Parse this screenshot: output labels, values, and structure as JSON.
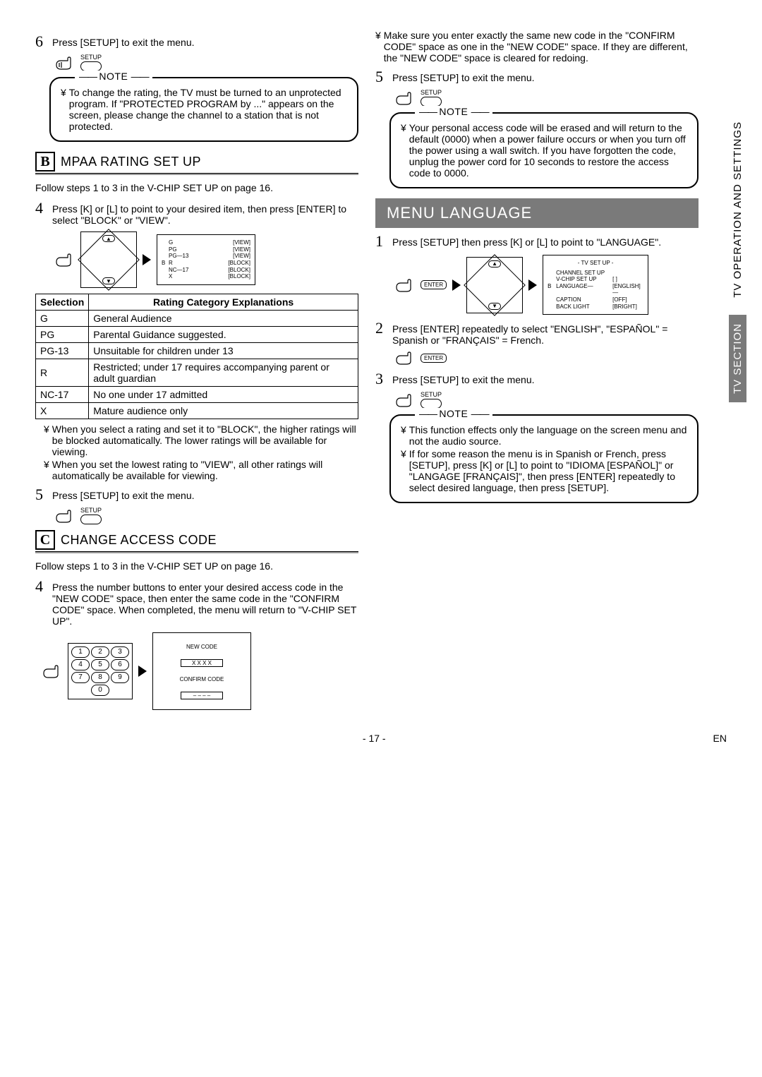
{
  "left": {
    "step6_text": "Press [SETUP] to exit the menu.",
    "setup_label": "SETUP",
    "note1_title": "NOTE",
    "note1_text": "To change the rating, the TV must be turned to an unprotected program. If \"PROTECTED PROGRAM by ...\" appears on the screen, please change the channel to a station that is not protected.",
    "sectionB_letter": "B",
    "sectionB_title": "MPAA RATING SET UP",
    "follow_b": "Follow steps 1 to 3 in the V-CHIP SET UP on page 16.",
    "step4b_text": "Press [K] or [L] to point to your desired item, then press [ENTER] to select \"BLOCK\" or \"VIEW\".",
    "rating_screen": [
      {
        "mark": "",
        "code": "G",
        "state": "[VIEW]"
      },
      {
        "mark": "",
        "code": "PG",
        "state": "[VIEW]"
      },
      {
        "mark": "",
        "code": "PG—13",
        "state": "[VIEW]"
      },
      {
        "mark": "B",
        "code": "R",
        "state": "[BLOCK]"
      },
      {
        "mark": "",
        "code": "NC—17",
        "state": "[BLOCK]"
      },
      {
        "mark": "",
        "code": "X",
        "state": "[BLOCK]"
      }
    ],
    "table_h1": "Selection",
    "table_h2": "Rating Category Explanations",
    "table_rows": [
      {
        "s": "G",
        "e": "General Audience"
      },
      {
        "s": "PG",
        "e": "Parental Guidance suggested."
      },
      {
        "s": "PG-13",
        "e": "Unsuitable for children under 13"
      },
      {
        "s": "R",
        "e": "Restricted; under 17 requires accompanying parent or adult guardian"
      },
      {
        "s": "NC-17",
        "e": "No one under 17 admitted"
      },
      {
        "s": "X",
        "e": "Mature audience only"
      }
    ],
    "bullets_b1": "When you select a rating and set it to \"BLOCK\", the higher ratings will be blocked automatically. The lower ratings will be available for viewing.",
    "bullets_b2": "When you set the lowest rating to \"VIEW\", all other ratings will automatically be available for viewing.",
    "step5b_text": "Press [SETUP] to exit the menu.",
    "sectionC_letter": "C",
    "sectionC_title": "CHANGE ACCESS CODE",
    "follow_c": "Follow steps 1 to 3 in the V-CHIP SET UP on page 16.",
    "step4c_text": "Press the number buttons to enter your desired access code in the \"NEW CODE\" space, then enter the same code in the \"CONFIRM CODE\" space. When completed, the menu will return to \"V-CHIP SET UP\".",
    "keypad": [
      "1",
      "2",
      "3",
      "4",
      "5",
      "6",
      "7",
      "8",
      "9",
      "0"
    ],
    "code_screen_new": "NEW CODE",
    "code_screen_new_val": "X X X X",
    "code_screen_confirm": "CONFIRM CODE",
    "code_screen_confirm_val": "– – – –"
  },
  "right": {
    "bullet_top": "Make sure you enter exactly the same new code in the \"CONFIRM CODE\" space as one in the \"NEW CODE\" space. If they are different, the \"NEW CODE\" space is cleared for redoing.",
    "step5r_text": "Press [SETUP] to exit the menu.",
    "setup_label": "SETUP",
    "note2_title": "NOTE",
    "note2_text": "Your personal access code will be erased and will return to the default (0000) when a power failure occurs or when you turn off the power using a wall switch. If you have forgotten the code, unplug the power cord for 10 seconds to restore the access code to 0000.",
    "menu_title": "MENU LANGUAGE",
    "step1m_text": "Press [SETUP] then press [K] or [L] to point to \"LANGUAGE\".",
    "enter_label": "ENTER",
    "tv_menu_title": "- TV SET UP -",
    "tv_menu_lines": [
      {
        "m": "",
        "l": "CHANNEL SET UP",
        "r": ""
      },
      {
        "m": "",
        "l": "V-CHIP SET UP",
        "r": "[    ]"
      },
      {
        "m": "B",
        "l": "LANGUAGE—",
        "r": "[ENGLISH]—"
      },
      {
        "m": "",
        "l": "CAPTION",
        "r": "[OFF]"
      },
      {
        "m": "",
        "l": "BACK LIGHT",
        "r": "[BRIGHT]"
      }
    ],
    "step2m_text": "Press [ENTER] repeatedly to select \"ENGLISH\", \"ESPAÑOL\" = Spanish or \"FRANÇAIS\" = French.",
    "step3m_text": "Press [SETUP] to exit the menu.",
    "note3_title": "NOTE",
    "note3_b1": "This function effects only the language on the screen menu and not the audio source.",
    "note3_b2": "If for some reason the menu is in Spanish or French, press [SETUP], press [K] or [L] to point to \"IDIOMA [ESPAÑOL]\" or \"LANGAGE [FRANÇAIS]\", then press [ENTER] repeatedly to select desired language, then press [SETUP]."
  },
  "side": {
    "tab1": "TV OPERATION AND SETTINGS",
    "tab2": "TV SECTION"
  },
  "footer": {
    "page": "- 17 -",
    "lang": "EN"
  },
  "glyph": {
    "yen": "¥"
  }
}
